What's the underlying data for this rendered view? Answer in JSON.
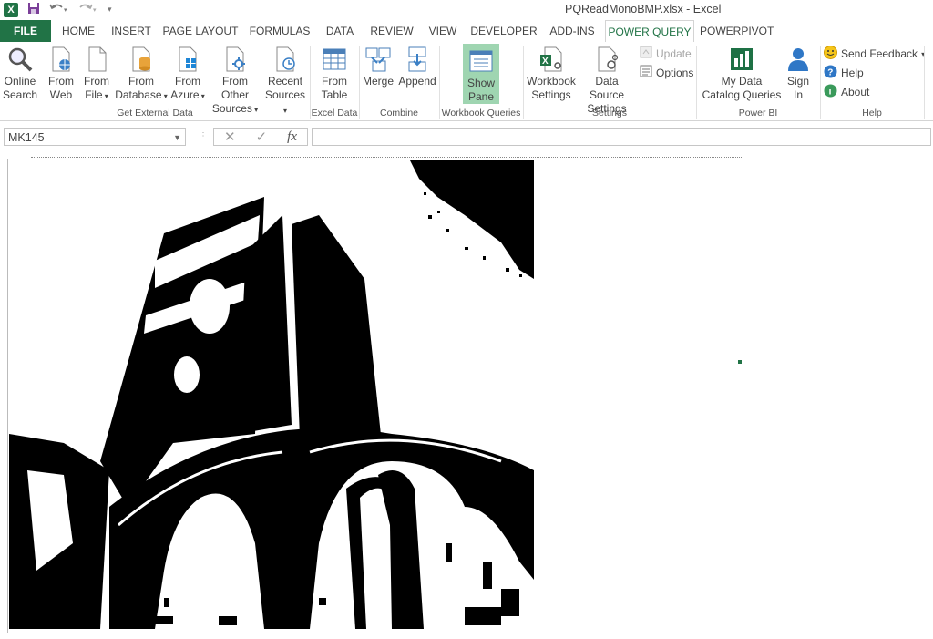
{
  "window": {
    "title": "PQReadMonoBMP.xlsx - Excel"
  },
  "qat": {
    "logo": "X"
  },
  "tabs": [
    "FILE",
    "HOME",
    "INSERT",
    "PAGE LAYOUT",
    "FORMULAS",
    "DATA",
    "REVIEW",
    "VIEW",
    "DEVELOPER",
    "ADD-INS",
    "POWER QUERY",
    "POWERPIVOT"
  ],
  "ribbon": {
    "get_external": {
      "label": "Get External Data",
      "online_search": [
        "Online",
        "Search"
      ],
      "from_web": [
        "From",
        "Web"
      ],
      "from_file": [
        "From",
        "File"
      ],
      "from_database": [
        "From",
        "Database"
      ],
      "from_azure": [
        "From",
        "Azure"
      ],
      "from_other": [
        "From Other",
        "Sources"
      ],
      "recent": [
        "Recent",
        "Sources"
      ]
    },
    "excel_data": {
      "label": "Excel Data",
      "from_table": [
        "From",
        "Table"
      ]
    },
    "combine": {
      "label": "Combine",
      "merge": "Merge",
      "append": "Append"
    },
    "workbook_queries": {
      "label": "Workbook Queries",
      "show_pane": [
        "Show",
        "Pane"
      ]
    },
    "settings": {
      "label": "Settings",
      "workbook": [
        "Workbook",
        "Settings"
      ],
      "data_source": [
        "Data Source",
        "Settings"
      ],
      "update": "Update",
      "options": "Options"
    },
    "power_bi": {
      "label": "Power BI",
      "catalog": [
        "My Data",
        "Catalog Queries"
      ],
      "sign_in": [
        "Sign",
        "In"
      ]
    },
    "help": {
      "label": "Help",
      "feedback": "Send Feedback",
      "help": "Help",
      "about": "About"
    }
  },
  "formula_bar": {
    "name_box": "MK145",
    "fx": "fx",
    "formula": ""
  },
  "colors": {
    "excel_green": "#217346",
    "show_pane_bg": "#9fd5b1"
  }
}
